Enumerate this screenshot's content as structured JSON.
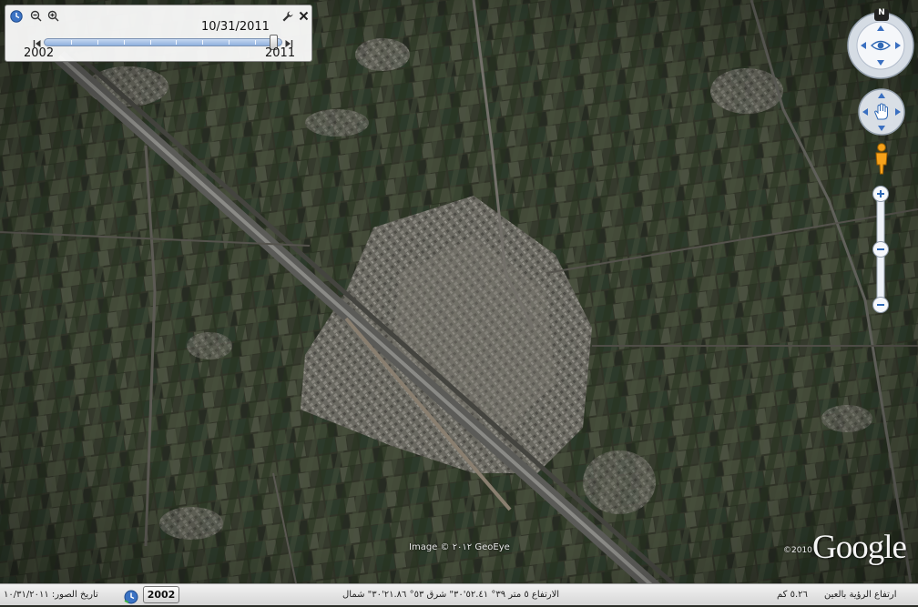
{
  "time_slider": {
    "current_date": "10/31/2011",
    "start_year": "2002",
    "end_year": "2011",
    "position": 1.0
  },
  "map": {
    "attribution": "Image © ٢٠١٢ GeoEye",
    "copyright": "©2010",
    "logo": "Google"
  },
  "status_bar": {
    "year_button": "2002",
    "imagery_date": "تاريخ الصور: ١٠/٣١/٢٠١١",
    "coordinates": "الارتفاع ٥ متر ٣٩° ٥٢.٤١'٣٠\" شرق ٥٣° ٢١.٨٦'٣٠\" شمال",
    "altitude": "٥.٢٦ كم",
    "eye_label": "ارتفاع الرؤية بالعين"
  },
  "icons": {
    "clock": "clock-icon",
    "zoom_out": "zoom-out-icon",
    "zoom_in": "zoom-in-icon",
    "wrench": "wrench-icon",
    "close": "close-icon",
    "north": "north-icon",
    "look": "eye-icon",
    "move": "hand-icon",
    "pegman": "pegman-icon",
    "zoom_plus": "plus-icon",
    "zoom_minus": "minus-icon"
  },
  "nav": {
    "north_label": "N"
  },
  "colors": {
    "slider_fill": "#8fb1de",
    "control_blue": "#2f68b4"
  }
}
